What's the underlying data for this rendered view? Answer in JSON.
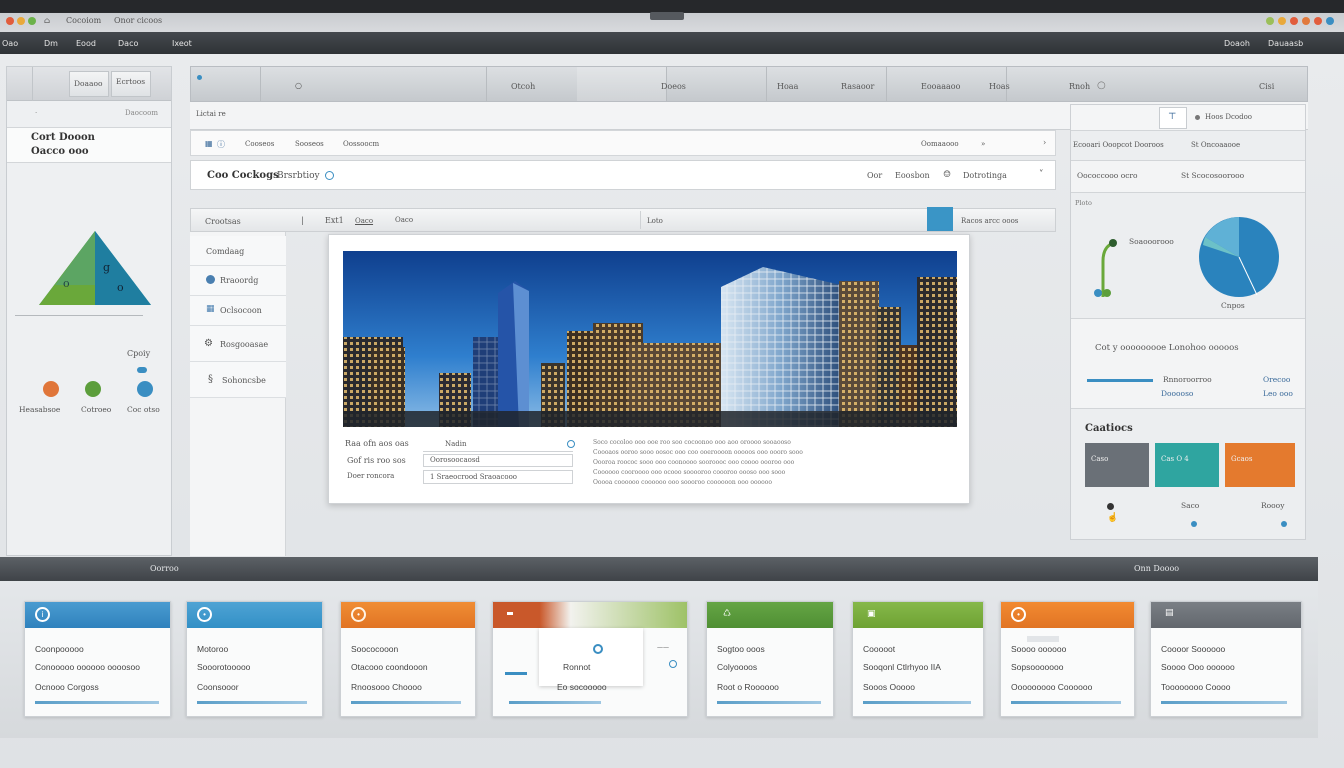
{
  "titlebar": {
    "tab1": "Cocoiom",
    "tab2": "Onor cicoos"
  },
  "menu": {
    "items": [
      "Oao",
      "Dm",
      "Eood",
      "Daco",
      "Ixeot"
    ],
    "right": [
      "Doaoh",
      "Dauaasb"
    ]
  },
  "sidebar": {
    "tabs": [
      "Doaaoo",
      "Ecrtoos"
    ],
    "filter_label": "Daocoom",
    "title_line1": "Cort Dooon",
    "title_line2": "Oacco ooo",
    "triangle_labels": [
      "o",
      "g",
      "o"
    ],
    "caption": "Cpoiy",
    "icons": [
      {
        "name": "Heasabsoe",
        "color": "#e0763a"
      },
      {
        "name": "Cotroeo",
        "color": "#5c9e3c"
      },
      {
        "name": "Coc otso",
        "color": "#3a8ec2"
      }
    ]
  },
  "main": {
    "header": [
      "Otcoh",
      "Doeos",
      "Hoaa",
      "Rasaoor",
      "Eooaaaoo",
      "Hoas",
      "Rnoh",
      "Cisi"
    ],
    "breadcrumb": "Lictai re",
    "row1": {
      "items": [
        "Cooseos",
        "Sooseos",
        "Oossoocm"
      ],
      "right": "Oomaaooo"
    },
    "row2": {
      "title": "Coo Cockogs",
      "sub": "Brsrbtioy",
      "right": [
        "Oor",
        "Eoosbon",
        "Dotrotinga"
      ]
    },
    "row3": {
      "left": "Crootsas",
      "mid": "Ext1",
      "mid2": "Oaco",
      "field": "Loto",
      "right": "Racos arcc ooos"
    },
    "list": [
      "Comdaag",
      "Rraoordg",
      "Oclsocoon",
      "Rosgooasae",
      "Sohoncsbe"
    ]
  },
  "card": {
    "form": [
      {
        "label": "Raa ofn aos oas",
        "value": "Nadin"
      },
      {
        "label": "Gof ris roo sos",
        "value": "Oorosoocaosd"
      },
      {
        "label": "Doer roncora",
        "value": "1 Sraeocrood Sraoacooo"
      }
    ],
    "paragraph": [
      "Soco cocoloo ooo ooe roo soo cocoonoo ooo aoo oroooo sooaooso",
      "Coooaos ooroo sooo oosoc ooo coo ooeroooon ooooos ooo oooro sooo",
      "Oooroa roococ sooo ooo coonoooo sooroooc ooo coooo oooroo ooo",
      "Coooooo cooroooo ooo ocooo sooooroo coooroo oooso ooo sooo",
      "Ooooa coooooo coooooo ooo soooroo coooooon ooo oooooo"
    ]
  },
  "rightpanel": {
    "toolbar": "Hoos Dcodoo",
    "row1": [
      "Ecooari Ooopcot Dooroos",
      "St Oncoaaooe"
    ],
    "row2": [
      "Oococcooo ocro",
      "St Scocosoorooo"
    ],
    "chart_caption": "Ploto",
    "chart_label": "Soaooorooo",
    "chart_sub": "Cnpos",
    "info_title": "Cot y ooooooooe Lonohoo ooooos",
    "info_right": [
      "Rnnoroorroo",
      "Dooooso",
      "Orecoo",
      "Leo ooo"
    ],
    "section_title": "Caatiocs",
    "swatches": [
      {
        "label": "Caso",
        "color": "#6a7077"
      },
      {
        "label": "Cas O 4",
        "color": "#2fa5a0"
      },
      {
        "label": "Gcaos",
        "color": "#e47a2e"
      }
    ],
    "bottom": [
      "Saco",
      "Roooy"
    ]
  },
  "bottombar": {
    "left": "Oorroo",
    "right": "Onn Doooo"
  },
  "tiles": [
    {
      "color": "#3b8ec4",
      "lines": [
        "Coonpooooo",
        "Conooooo oooooo oooosoo",
        "Ocnooo Corgoss"
      ]
    },
    {
      "color": "#3b94c9",
      "lines": [
        "Motoroo",
        "Sooorotooooo",
        "Coonsooor"
      ]
    },
    {
      "color": "#e9812b",
      "lines": [
        "Soococooon",
        "Otacooo coondooon",
        "Rnoosooo Choooo"
      ]
    },
    {
      "color": "#c9582a",
      "lines": [
        "Ronnot",
        "Eo socooooo"
      ]
    },
    {
      "color": "#5c9c3a",
      "lines": [
        "Sogtoo ooos",
        "Colyoooos",
        "Root o Roooooo"
      ]
    },
    {
      "color": "#79ad3c",
      "lines": [
        "Cooooot",
        "Sooqonl Ctlrhyoo IIA",
        "Sooos Ooooo"
      ]
    },
    {
      "color": "#ea7b2a",
      "lines": [
        "Soooo oooooo",
        "Sopsooooooo",
        "Ooooooooo Coooooo"
      ]
    },
    {
      "color": "#6d7278",
      "lines": [
        "Coooor Soooooo",
        "Soooo Ooo oooooo",
        "Toooooooo Coooo"
      ]
    }
  ]
}
